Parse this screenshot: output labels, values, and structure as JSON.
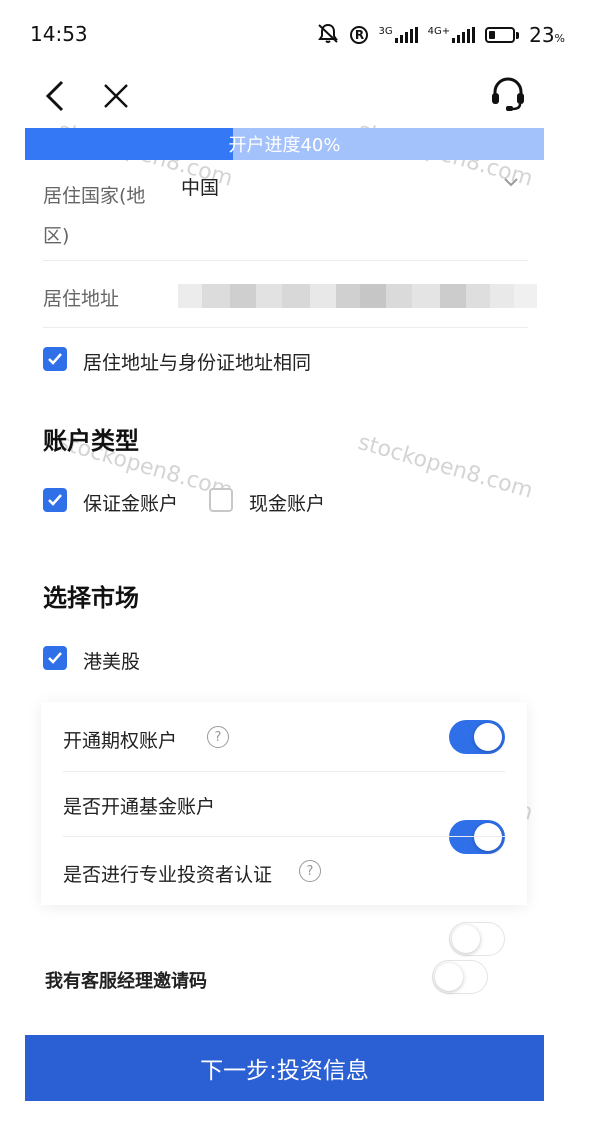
{
  "status_bar": {
    "time": "14:53",
    "net1": "3G",
    "net2": "4G+",
    "battery_value": "23",
    "battery_unit": "%",
    "icons": [
      "mute-bell-icon",
      "registered-icon",
      "signal-icon",
      "battery-icon"
    ]
  },
  "nav": {
    "back_icon": "chevron-left-icon",
    "close_icon": "close-icon",
    "support_icon": "headset-icon"
  },
  "progress": {
    "label": "开户进度40%",
    "value": 0.4
  },
  "form": {
    "country_label_line1": "居住国家(地",
    "country_label_line2": "区)",
    "country_value": "中国",
    "address_label": "居住地址",
    "same_address_label": "居住地址与身份证地址相同",
    "same_address_checked": true
  },
  "account_type": {
    "title": "账户类型",
    "options": [
      {
        "label": "保证金账户",
        "checked": true
      },
      {
        "label": "现金账户",
        "checked": false
      }
    ]
  },
  "market": {
    "title": "选择市场",
    "options": [
      {
        "label": "港美股",
        "checked": true
      }
    ]
  },
  "toggles": [
    {
      "label": "开通期权账户",
      "on": true,
      "help": true
    },
    {
      "label": "是否开通基金账户",
      "on": true,
      "help": false
    },
    {
      "label": "是否进行专业投资者认证",
      "on": false,
      "help": true
    }
  ],
  "invite": {
    "label": "我有客服经理邀请码",
    "on": false
  },
  "next_button": "下一步:投资信息",
  "watermark": "stockopen8.com",
  "colors": {
    "accent": "#2f6fe8",
    "progress_fill": "#3478f6",
    "progress_track": "#a3c1fb",
    "button": "#2b5fd4"
  }
}
